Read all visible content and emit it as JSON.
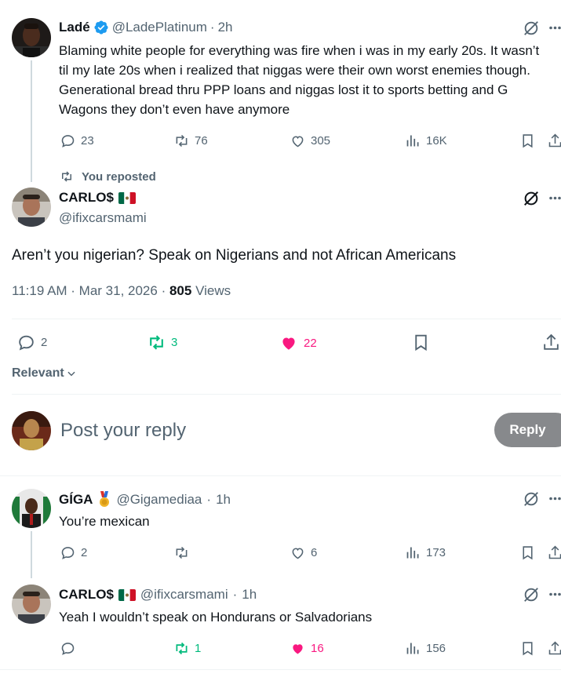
{
  "post1": {
    "name": "Ladé",
    "handle": "@LadePlatinum",
    "separator": "·",
    "time": "2h",
    "text": "Blaming white people for everything was fire when i was in my early 20s. It wasn’t til my late 20s when i realized that niggas were their own worst enemies though. Generational bread thru PPP loans and niggas lost it to sports betting and G Wagons they don’t even have anymore",
    "replies": "23",
    "reposts": "76",
    "likes": "305",
    "views": "16K"
  },
  "repost_label": "You reposted",
  "main": {
    "name": "CARLO$",
    "handle": "@ifixcarsmami",
    "text": "Aren’t you nigerian? Speak on Nigerians and not African Americans",
    "timestamp": "11:19 AM · Mar 31, 2026 · ",
    "views_count": "805",
    "views_label": " Views",
    "replies": "2",
    "reposts": "3",
    "likes": "22"
  },
  "sort_label": "Relevant",
  "composer": {
    "placeholder": "Post your reply",
    "button": "Reply"
  },
  "reply1": {
    "name": "GÍGA",
    "handle": "@Gigamediaa",
    "separator": "·",
    "time": "1h",
    "text": "You’re mexican",
    "replies": "2",
    "reposts": "",
    "likes": "6",
    "views": "173"
  },
  "reply2": {
    "name": "CARLO$",
    "handle": "@ifixcarsmami",
    "separator": "·",
    "time": "1h",
    "text": "Yeah I wouldn’t speak on Hondurans or Salvadorians",
    "replies": "",
    "reposts": "1",
    "likes": "16",
    "views": "156"
  },
  "colors": {
    "text": "#0f1419",
    "muted": "#536471",
    "verified": "#1d9bf0",
    "repost_active": "#00ba7c",
    "like_active": "#f91880",
    "reply_button": "#87898c",
    "divider": "#eff3f4"
  },
  "icons": [
    "grok-icon",
    "more-icon",
    "reply-icon",
    "repost-icon",
    "like-icon",
    "views-icon",
    "bookmark-icon",
    "share-icon",
    "verified-badge-icon",
    "mexico-flag-icon",
    "medal-icon",
    "chevron-down-icon"
  ]
}
